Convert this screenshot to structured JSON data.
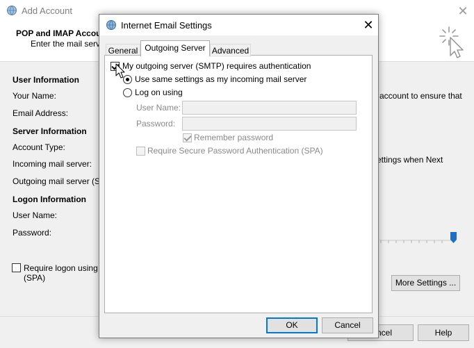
{
  "background_window": {
    "title": "Add Account",
    "close_glyph": "✕",
    "header": {
      "title": "POP and IMAP Accou",
      "subtitle": "Enter the mail server"
    },
    "sections": {
      "user_info": "User Information",
      "server_info": "Server Information",
      "logon_info": "Logon Information"
    },
    "labels": {
      "your_name": "Your Name:",
      "email_address": "Email Address:",
      "account_type": "Account Type:",
      "incoming_server": "Incoming mail server:",
      "outgoing_server": "Outgoing mail server (SN",
      "user_name": "User Name:",
      "password": "Password:"
    },
    "right_text_1": "account to ensure that",
    "right_text_2": "ettings when Next",
    "require_spa": "Require logon using (SPA)",
    "require_spa_line1": "Require logon using",
    "require_spa_line2": "(SPA)",
    "more_settings_button": "More Settings ...",
    "cancel_button": "ncel",
    "help_button": "Help"
  },
  "dialog": {
    "title": "Internet Email Settings",
    "close_glyph": "✕",
    "tabs": [
      {
        "label": "General",
        "active": false
      },
      {
        "label": "Outgoing Server",
        "active": true
      },
      {
        "label": "Advanced",
        "active": false
      }
    ],
    "requires_auth": {
      "label": "My outgoing server (SMTP) requires authentication",
      "checked": true
    },
    "use_same_settings": {
      "label": "Use same settings as my incoming mail server",
      "selected": true
    },
    "log_on_using": {
      "label": "Log on using",
      "selected": false
    },
    "user_name_label": "User Name:",
    "user_name_value": "",
    "password_label": "Password:",
    "password_value": "",
    "remember_password": {
      "label": "Remember password",
      "checked": true,
      "enabled": false
    },
    "require_spa": {
      "label": "Require Secure Password Authentication (SPA)",
      "checked": false,
      "enabled": false
    },
    "ok_button": "OK",
    "cancel_button": "Cancel"
  },
  "colors": {
    "window_bg": "#f0f0f0",
    "accent": "#0078d7",
    "slider_thumb": "#1e6fc4",
    "disabled_text": "#8a8a8a"
  },
  "icons": {
    "window_icon": "globe-envelope-icon",
    "wizard_icon": "cursor-sparkle-icon",
    "close_icon": "close-icon",
    "mouse_cursor": "arrow-cursor-icon"
  }
}
